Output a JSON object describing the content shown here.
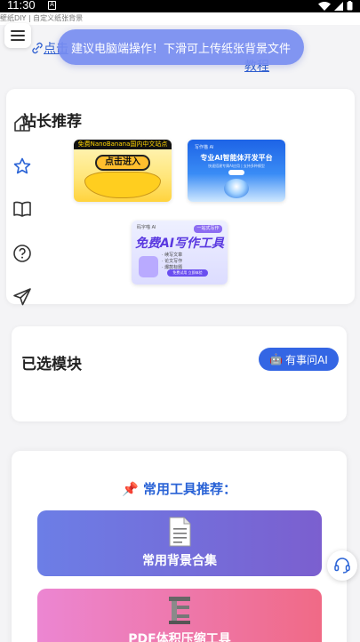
{
  "status": {
    "time": "11:30"
  },
  "breadcrumb": "壁纸DIY | 自定义纸张背景",
  "links": {
    "click": "点击",
    "tutorial": "教程"
  },
  "toast": "建议电脑端操作！下滑可上传纸张背景文件",
  "recommend": {
    "title": "站长推荐",
    "banners": [
      {
        "tag": "免费NanoBanana国内中文站点",
        "cta": "点击进入"
      },
      {
        "small": "写作猫 AI",
        "head": "专业AI智能体开发平台",
        "sub": "快速搭建专属AI应用 | 支持多种模型",
        "btn": "立即体验"
      },
      {
        "small": "码字喵 AI",
        "tag": "一站式写作",
        "head": "免费AI写作工具",
        "items": [
          "· 续写文章",
          "· 论文写作",
          "· 爆款标题"
        ],
        "btn": "免费试用 立即体验"
      }
    ]
  },
  "selected": {
    "title": "已选模块",
    "ai_button": "有事问AI"
  },
  "tools": {
    "title": "📌 常用工具推荐：",
    "items": [
      {
        "label": "常用背景合集"
      },
      {
        "label": "PDF体积压缩工具"
      }
    ]
  },
  "colors": {
    "accent": "#3466e4",
    "toast": "#768cf0",
    "tool1": "#6c7ee6",
    "tool2": "#f06a86"
  }
}
